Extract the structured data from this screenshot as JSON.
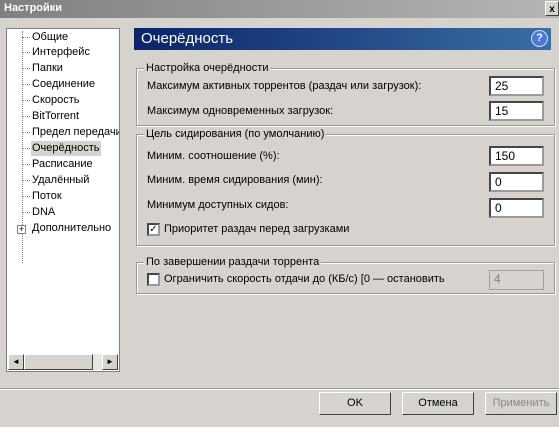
{
  "window": {
    "title": "Настройки",
    "close_glyph": "x"
  },
  "sidebar": {
    "items": [
      {
        "label": "Общие"
      },
      {
        "label": "Интерфейс"
      },
      {
        "label": "Папки"
      },
      {
        "label": "Соединение"
      },
      {
        "label": "Скорость"
      },
      {
        "label": "BitTorrent"
      },
      {
        "label": "Предел передачи"
      },
      {
        "label": "Очерёдность",
        "selected": true
      },
      {
        "label": "Расписание"
      },
      {
        "label": "Удалённый"
      },
      {
        "label": "Поток"
      },
      {
        "label": "DNA"
      },
      {
        "label": "Дополнительно",
        "expandable": true
      }
    ],
    "expander_glyph": "+",
    "scroll_left_glyph": "◄",
    "scroll_right_glyph": "►"
  },
  "page": {
    "title": "Очерёдность",
    "help_glyph": "?"
  },
  "queue_settings": {
    "legend": "Настройка очерёдности",
    "max_active_label": "Максимум активных торрентов (раздач или загрузок):",
    "max_active_value": "25",
    "max_downloads_label": "Максимум одновременных загрузок:",
    "max_downloads_value": "15"
  },
  "seeding_goal": {
    "legend": "Цель сидирования (по умолчанию)",
    "ratio_label": "Миним. соотношение (%):",
    "ratio_value": "150",
    "time_label": "Миним. время сидирования (мин):",
    "time_value": "0",
    "seeds_label": "Минимум доступных сидов:",
    "seeds_value": "0",
    "priority_label": "Приоритет раздач перед загрузками",
    "priority_checked": true
  },
  "on_complete": {
    "legend": "По завершении раздачи торрента",
    "limit_label": "Ограничить скорость отдачи до (КБ/с) [0 — остановить",
    "limit_checked": false,
    "limit_value": "4"
  },
  "buttons": {
    "ok": "OK",
    "cancel": "Отмена",
    "apply": "Применить"
  },
  "colors": {
    "header_start": "#0a246a",
    "header_end": "#3a6ea5",
    "face": "#d6d3ce"
  }
}
